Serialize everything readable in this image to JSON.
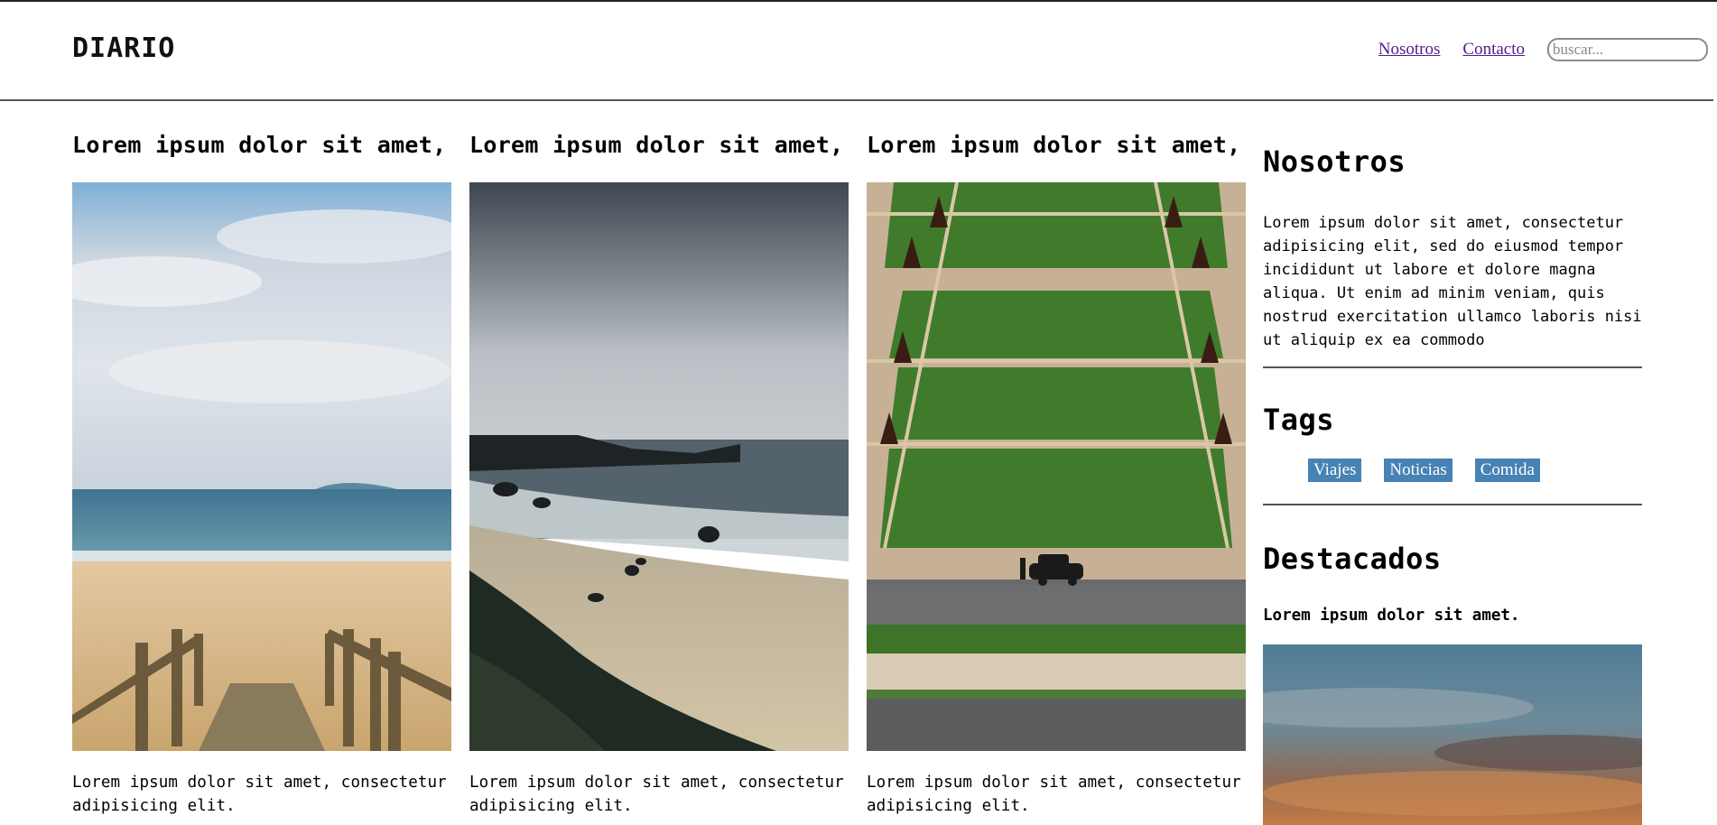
{
  "header": {
    "brand": "DIARIO",
    "nav": [
      "Nosotros",
      "Contacto"
    ],
    "search_placeholder": "buscar..."
  },
  "posts": [
    {
      "title": "Lorem ipsum dolor sit amet,",
      "text": "Lorem ipsum dolor sit amet, consectetur adipisicing elit."
    },
    {
      "title": "Lorem ipsum dolor sit amet,",
      "text": "Lorem ipsum dolor sit amet, consectetur adipisicing elit."
    },
    {
      "title": "Lorem ipsum dolor sit amet,",
      "text": "Lorem ipsum dolor sit amet, consectetur adipisicing elit."
    }
  ],
  "sidebar": {
    "about_title": "Nosotros",
    "about_text": "Lorem ipsum dolor sit amet, consectetur adipisicing elit, sed do eiusmod tempor incididunt ut labore et dolore magna aliqua. Ut enim ad minim veniam, quis nostrud exercitation ullamco laboris nisi ut aliquip ex ea commodo",
    "tags_title": "Tags",
    "tags": [
      "Viajes",
      "Noticias",
      "Comida"
    ],
    "featured_title": "Destacados",
    "featured_item": "Lorem ipsum dolor sit amet."
  },
  "colors": {
    "tag_bg": "#4682b4",
    "visited_link": "#551a8b"
  }
}
